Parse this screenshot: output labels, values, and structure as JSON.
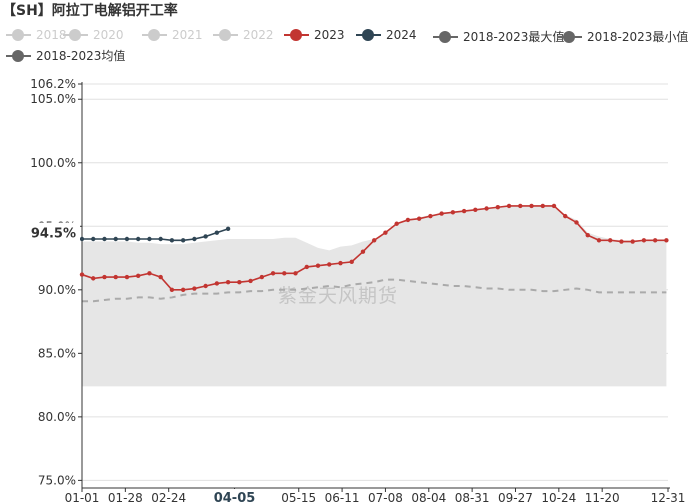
{
  "title": "【SH】阿拉丁电解铝开工率",
  "watermark": "紫金天风期货",
  "legend": [
    {
      "name": "2018",
      "color": "#cccccc",
      "inactive": true
    },
    {
      "name": "2020",
      "color": "#cccccc",
      "inactive": true
    },
    {
      "name": "2021",
      "color": "#cccccc",
      "inactive": true
    },
    {
      "name": "2022",
      "color": "#cccccc",
      "inactive": true
    },
    {
      "name": "2023",
      "color": "#c23531",
      "inactive": false
    },
    {
      "name": "2024",
      "color": "#2f4554",
      "inactive": false
    },
    {
      "name": "2018-2023最大值",
      "color": "#666666",
      "inactive": false
    },
    {
      "name": "2018-2023最小值",
      "color": "#666666",
      "inactive": false
    },
    {
      "name": "2018-2023均值",
      "color": "#666666",
      "inactive": false
    }
  ],
  "chart_data": {
    "type": "line",
    "title": "【SH】阿拉丁电解铝开工率",
    "x_ticks": [
      "01-01",
      "01-28",
      "02-24",
      "04-05",
      "05-15",
      "06-11",
      "07-08",
      "08-04",
      "08-31",
      "09-27",
      "10-24",
      "11-20",
      "12-31"
    ],
    "x_tick_days": [
      1,
      28,
      55,
      96,
      136,
      163,
      190,
      217,
      244,
      271,
      298,
      325,
      366
    ],
    "x_highlight": {
      "label": "04-05",
      "day": 96
    },
    "y_ticks": [
      "75.0%",
      "80.0%",
      "85.0%",
      "90.0%",
      "95.0%",
      "100.0%",
      "105.0%",
      "106.2%"
    ],
    "y_tick_values": [
      75.0,
      80.0,
      85.0,
      90.0,
      95.0,
      100.0,
      105.0,
      106.2
    ],
    "ylim": [
      74.4,
      106.2
    ],
    "y_highlight": {
      "label": "94.5%",
      "value": 94.5
    },
    "grid": true,
    "series": [
      {
        "name": "2023",
        "color": "#c23531",
        "x": [
          1,
          8,
          15,
          22,
          29,
          36,
          43,
          50,
          57,
          64,
          71,
          78,
          85,
          92,
          99,
          106,
          113,
          120,
          127,
          134,
          141,
          148,
          155,
          162,
          169,
          176,
          183,
          190,
          197,
          204,
          211,
          218,
          225,
          232,
          239,
          246,
          253,
          260,
          267,
          274,
          281,
          288,
          295,
          302,
          309,
          316,
          323,
          330,
          337,
          344,
          351,
          358,
          365
        ],
        "values": [
          91.2,
          90.9,
          91.0,
          91.0,
          91.0,
          91.1,
          91.3,
          91.0,
          90.0,
          90.0,
          90.1,
          90.3,
          90.5,
          90.6,
          90.6,
          90.7,
          91.0,
          91.3,
          91.3,
          91.3,
          91.8,
          91.9,
          92.0,
          92.1,
          92.2,
          93.0,
          93.9,
          94.5,
          95.2,
          95.5,
          95.6,
          95.8,
          96.0,
          96.1,
          96.2,
          96.3,
          96.4,
          96.5,
          96.6,
          96.6,
          96.6,
          96.6,
          96.6,
          95.8,
          95.3,
          94.3,
          93.9,
          93.9,
          93.8,
          93.8,
          93.9,
          93.9,
          93.9
        ]
      },
      {
        "name": "2024",
        "color": "#2f4554",
        "x": [
          1,
          8,
          15,
          22,
          29,
          36,
          43,
          50,
          57,
          64,
          71,
          78,
          85,
          92
        ],
        "values": [
          94.0,
          94.0,
          94.0,
          94.0,
          94.0,
          94.0,
          94.0,
          94.0,
          93.9,
          93.9,
          94.0,
          94.2,
          94.5,
          94.8
        ]
      },
      {
        "name": "2018-2023最大值",
        "color": "#e6e6e6",
        "area": true,
        "x": [
          1,
          8,
          15,
          22,
          29,
          36,
          43,
          50,
          57,
          64,
          71,
          78,
          85,
          92,
          99,
          106,
          113,
          120,
          127,
          134,
          141,
          148,
          155,
          162,
          169,
          176,
          183,
          190,
          197,
          204,
          211,
          218,
          225,
          232,
          239,
          246,
          253,
          260,
          267,
          274,
          281,
          288,
          295,
          302,
          309,
          316,
          323,
          330,
          337,
          344,
          351,
          358,
          365
        ],
        "values": [
          93.8,
          93.8,
          93.8,
          93.8,
          93.8,
          93.7,
          93.7,
          93.6,
          93.6,
          93.6,
          93.7,
          93.8,
          93.9,
          94.0,
          94.0,
          94.0,
          94.0,
          94.0,
          94.1,
          94.1,
          93.7,
          93.3,
          93.1,
          93.4,
          93.5,
          93.8,
          94.0,
          94.4,
          95.2,
          95.5,
          95.7,
          95.9,
          96.0,
          96.1,
          96.2,
          96.3,
          96.4,
          96.5,
          96.6,
          96.6,
          96.6,
          96.6,
          96.6,
          95.9,
          95.5,
          94.5,
          94.2,
          94.0,
          93.9,
          93.9,
          93.9,
          93.9,
          93.9
        ]
      },
      {
        "name": "2018-2023最小值",
        "color": "#e6e6e6",
        "area": true,
        "x": [
          1,
          365
        ],
        "values": [
          82.4,
          82.4
        ]
      },
      {
        "name": "2018-2023均值",
        "color": "#aaaaaa",
        "dashed": true,
        "x": [
          1,
          8,
          15,
          22,
          29,
          36,
          43,
          50,
          57,
          64,
          71,
          78,
          85,
          92,
          99,
          106,
          113,
          120,
          127,
          134,
          141,
          148,
          155,
          162,
          169,
          176,
          183,
          190,
          197,
          204,
          211,
          218,
          225,
          232,
          239,
          246,
          253,
          260,
          267,
          274,
          281,
          288,
          295,
          302,
          309,
          316,
          323,
          330,
          337,
          344,
          351,
          358,
          365
        ],
        "values": [
          89.1,
          89.1,
          89.2,
          89.3,
          89.3,
          89.4,
          89.4,
          89.3,
          89.4,
          89.6,
          89.7,
          89.7,
          89.7,
          89.8,
          89.8,
          89.9,
          89.9,
          90.0,
          90.0,
          90.0,
          90.1,
          90.2,
          90.3,
          90.2,
          90.4,
          90.5,
          90.6,
          90.8,
          90.8,
          90.7,
          90.6,
          90.5,
          90.4,
          90.3,
          90.3,
          90.2,
          90.1,
          90.1,
          90.0,
          90.0,
          90.0,
          89.9,
          89.9,
          90.0,
          90.1,
          90.0,
          89.8,
          89.8,
          89.8,
          89.8,
          89.8,
          89.8,
          89.8
        ]
      }
    ]
  }
}
